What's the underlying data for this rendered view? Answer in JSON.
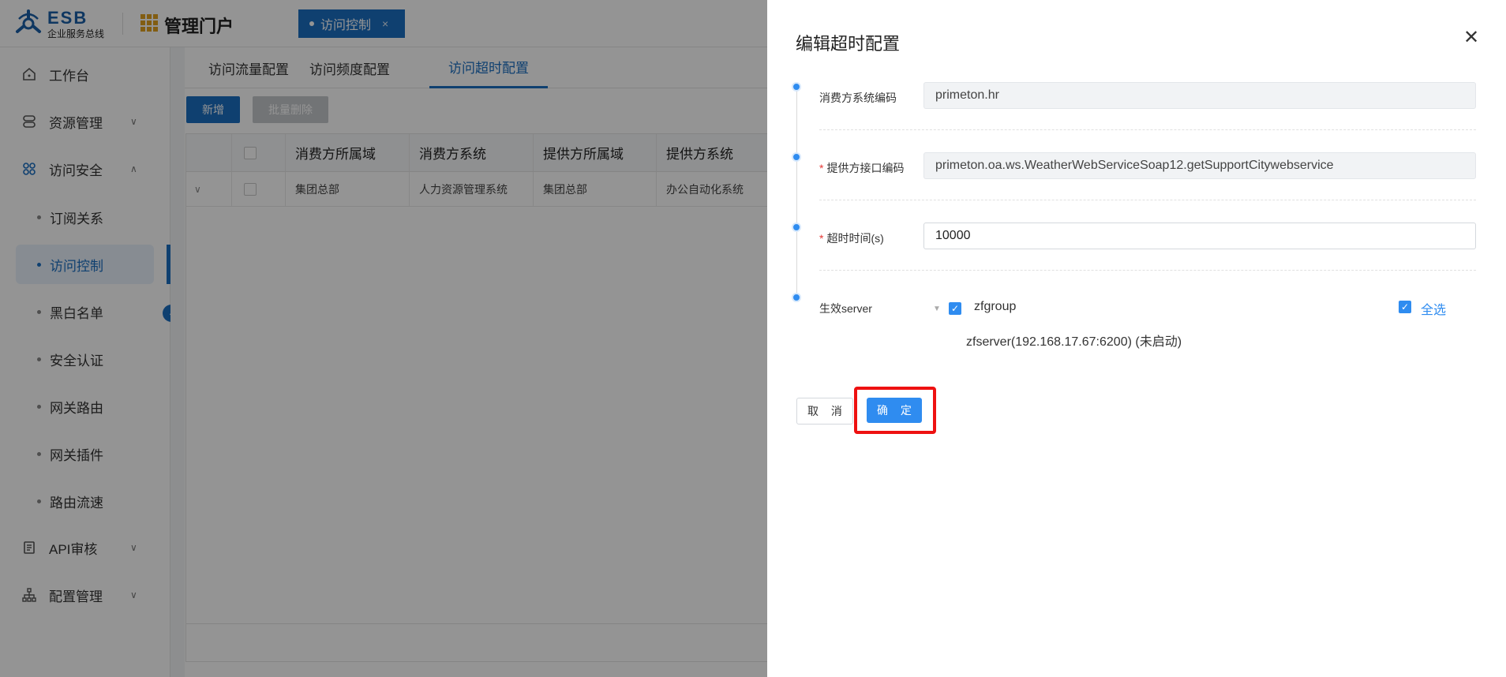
{
  "brand": {
    "logo_title": "ESB",
    "logo_subtitle": "企业服务总线",
    "portal_title": "管理门户",
    "accent": "#1b6ec2"
  },
  "open_tab": {
    "label": "访问控制",
    "close": "×"
  },
  "sidebar": {
    "items": [
      {
        "label": "工作台",
        "icon": "home-icon"
      },
      {
        "label": "资源管理",
        "icon": "database-icon",
        "chevron": "∨"
      },
      {
        "label": "访问安全",
        "icon": "apps-icon",
        "chevron": "∧"
      },
      {
        "label": "订阅关系"
      },
      {
        "label": "访问控制",
        "active": true
      },
      {
        "label": "黑白名单"
      },
      {
        "label": "安全认证"
      },
      {
        "label": "网关路由"
      },
      {
        "label": "网关插件"
      },
      {
        "label": "路由流速"
      },
      {
        "label": "API审核",
        "icon": "document-icon",
        "chevron": "∨"
      },
      {
        "label": "配置管理",
        "icon": "sitemap-icon",
        "chevron": "∨"
      }
    ],
    "collapse_icon": "‹"
  },
  "content": {
    "tabs": [
      {
        "label": "访问流量配置"
      },
      {
        "label": "访问频度配置"
      },
      {
        "label": "访问超时配置",
        "active": true
      }
    ],
    "add_button": "新增",
    "batch_delete_button": "批量删除",
    "table": {
      "columns": [
        "消费方所属域",
        "消费方系统",
        "提供方所属域",
        "提供方系统"
      ],
      "rows": [
        [
          "集团总部",
          "人力资源管理系统",
          "集团总部",
          "办公自动化系统"
        ]
      ]
    }
  },
  "drawer": {
    "title": "编辑超时配置",
    "close_icon": "✕",
    "fields": {
      "consumer_code": {
        "label": "消费方系统编码",
        "value": "primeton.hr"
      },
      "provider_interface": {
        "label": "提供方接口编码",
        "value": "primeton.oa.ws.WeatherWebServiceSoap12.getSupportCitywebservice",
        "required": "*"
      },
      "timeout": {
        "label": "超时时间(s)",
        "value": "10000",
        "required": "*"
      },
      "server": {
        "label": "生效server"
      }
    },
    "server_tree": {
      "group": "zfgroup",
      "group_checked": true,
      "server": "zfserver(192.168.17.67:6200) (未启动)",
      "select_all": "全选",
      "select_all_checked": true
    },
    "cancel_button": "取 消",
    "ok_button": "确 定",
    "highlight_color": "#ee1111"
  }
}
